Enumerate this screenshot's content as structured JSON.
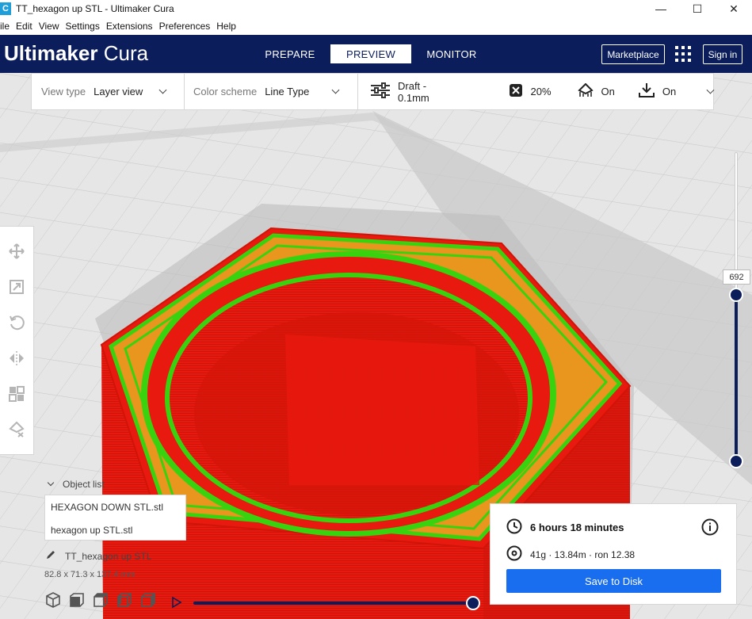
{
  "window": {
    "app_icon_letter": "C",
    "title": "TT_hexagon up STL - Ultimaker Cura",
    "minimize": "—",
    "maximize": "☐",
    "close": "✕"
  },
  "menu": [
    "ile",
    "Edit",
    "View",
    "Settings",
    "Extensions",
    "Preferences",
    "Help"
  ],
  "header": {
    "brand_bold": "Ultimaker",
    "brand_light": "Cura",
    "tabs": [
      "PREPARE",
      "PREVIEW",
      "MONITOR"
    ],
    "active_tab": "PREVIEW",
    "marketplace": "Marketplace",
    "sign_in": "Sign in"
  },
  "settings_bar": {
    "view_type_label": "View type",
    "view_type_value": "Layer view",
    "color_scheme_label": "Color scheme",
    "color_scheme_value": "Line Type",
    "profile": "Draft - 0.1mm",
    "infill": "20%",
    "support": "On",
    "adhesion": "On"
  },
  "layer_slider": {
    "current_layer": "692",
    "level": 1.0
  },
  "object_list": {
    "header": "Object list",
    "items": [
      "HEXAGON DOWN STL.stl",
      "hexagon up STL.stl"
    ],
    "current_object": "TT_hexagon up STL",
    "dimensions": "82.8 x 71.3 x 137.4 mm"
  },
  "print_info": {
    "time": "6 hours 18 minutes",
    "material": "41g · 13.84m · ron 12.38",
    "save_button": "Save to Disk"
  },
  "colors": {
    "header_bg": "#0b1e5b",
    "accent_blue": "#196ef0",
    "wall_red": "#e8190e",
    "inner_wall_green": "#39d20f",
    "infill_orange": "#e8961e",
    "build_plate": "#e6e6e6"
  }
}
